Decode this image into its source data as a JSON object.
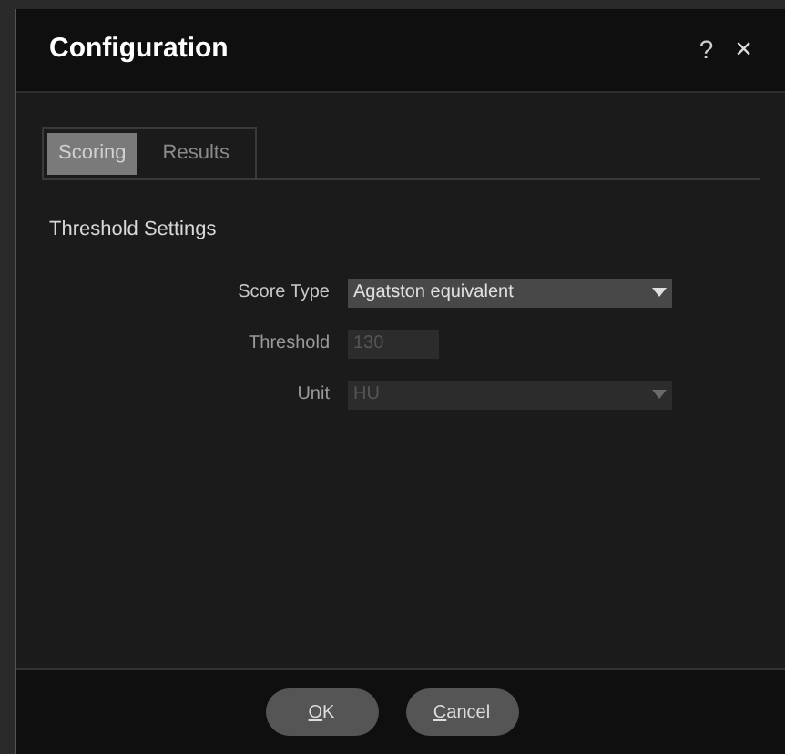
{
  "window": {
    "title": "Configuration",
    "help": "?",
    "close": "×"
  },
  "tabs": [
    {
      "label": "Scoring",
      "selected": true
    },
    {
      "label": "Results",
      "selected": false
    }
  ],
  "section": {
    "title": "Threshold Settings"
  },
  "fields": [
    {
      "kind": "dropdown",
      "label": "Score Type",
      "value": "Agatston equivalent",
      "disabled": false
    },
    {
      "kind": "text",
      "label": "Threshold",
      "value": "130",
      "disabled": true
    },
    {
      "kind": "dropdown",
      "label": "Unit",
      "value": "HU",
      "disabled": true
    }
  ],
  "buttons": [
    {
      "label": "OK"
    },
    {
      "label": "Cancel"
    }
  ]
}
